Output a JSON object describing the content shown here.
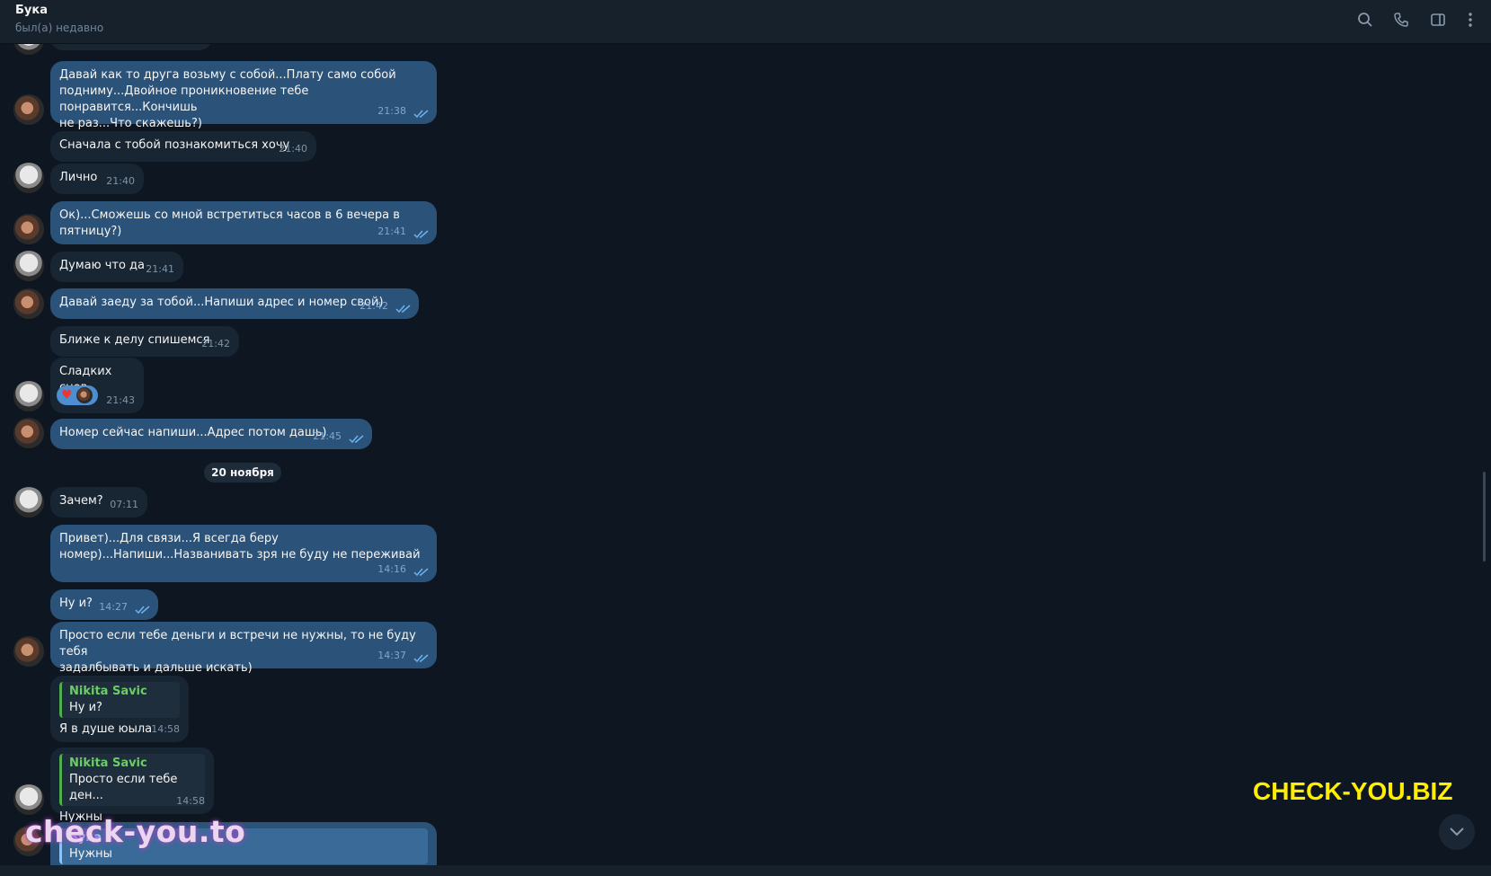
{
  "header": {
    "name": "Бука",
    "status": "был(а) недавно",
    "icons": [
      "search-icon",
      "phone-icon",
      "sidebar-toggle-icon",
      "more-vertical-icon"
    ]
  },
  "messages": [
    {
      "text": "Давай как то друга возьму с собой...Плату само собой\nподниму...Двойное проникновение тебе понравится...Кончишь\nне раз...Что скажешь?)",
      "time": "21:38"
    },
    {
      "text": "Сначала с тобой познакомиться хочу",
      "time": "21:40"
    },
    {
      "text": "Лично",
      "time": "21:40"
    },
    {
      "text": "Ок)...Сможешь со мной встретиться часов в 6 вечера в пятницу?)",
      "time": "21:41"
    },
    {
      "text": "Думаю что да",
      "time": "21:41"
    },
    {
      "text": "Давай заеду за тобой...Напиши адрес и номер свой)",
      "time": "21:42"
    },
    {
      "text": "Ближе к делу спишемся",
      "time": "21:42"
    },
    {
      "text": "Сладких снов",
      "time": "21:43"
    },
    {
      "text": "Номер сейчас напиши...Адрес потом дашь)",
      "time": "21:45"
    },
    {
      "text": "Зачем?",
      "time": "07:11"
    },
    {
      "text": "Привет)...Для связи...Я всегда беру\nномер)...Напиши...Названивать зря не буду не переживай",
      "time": "14:16"
    },
    {
      "text": "Ну и?",
      "time": "14:27"
    },
    {
      "text": "Просто если тебе деньги и встречи не нужны, то не буду тебя\nзадалбывать и дальше искать)",
      "time": "14:37"
    },
    {
      "reply_author": "Nikita Savic",
      "reply_text": "Ну и?",
      "text": "Я в душе юыла",
      "time": "14:58"
    },
    {
      "reply_author": "Nikita Savic",
      "reply_text": "Просто если тебе ден...",
      "text": "Нужны",
      "time": "14:58"
    },
    {
      "reply_author": "Бука",
      "reply_text": "Нужны"
    }
  ],
  "date_separator": "20 ноября",
  "reaction": {
    "emoji": "♥"
  },
  "watermarks": {
    "left": "check-you.to",
    "right": "CHECK-YOU.BIZ"
  },
  "colors": {
    "background": "#0e1621",
    "incoming_bubble": "#182533",
    "outgoing_bubble": "#2b5278",
    "accent_check": "#6ab3f3",
    "reply_name": "#6ecb6a"
  }
}
